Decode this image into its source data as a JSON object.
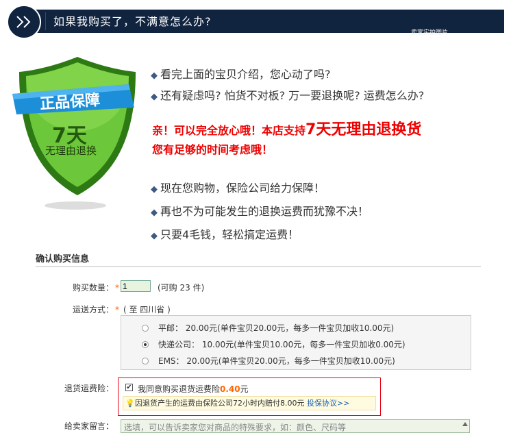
{
  "banner": {
    "title": "如果我购买了，不满意怎么办?",
    "faint_text": "卖家实拍图片"
  },
  "shield": {
    "ribbon": "正品保障",
    "days": "7天",
    "sub": "无理由退换"
  },
  "intro": {
    "bullet_glyph": "◆",
    "lines": [
      "看完上面的宝贝介绍，您心动了吗?",
      "还有疑虑吗? 怕货不对板? 万一要退换呢? 运费怎么办?"
    ],
    "red_line1_a": "亲！可以完全放心哦！本店支持",
    "red_line1_big": "7天无理由退换货",
    "red_line2": "您有足够的时间考虑哦！",
    "lines2": [
      "现在您购物，保险公司给力保障！",
      "再也不为可能发生的退换运费而犹豫不决！",
      "只要4毛钱，轻松搞定运费！"
    ]
  },
  "form": {
    "section_title": "确认购买信息",
    "qty_label": "购买数量：",
    "required_mark": "*",
    "qty_value": "1",
    "qty_note": "(可购 23 件)",
    "ship_label": "运送方式：",
    "ship_note": "( 至 四川省 )",
    "ship_options": [
      {
        "label": "平邮：  20.00元(单件宝贝20.00元，每多一件宝贝加收10.00元)",
        "selected": false
      },
      {
        "label": "快递公司：  10.00元(单件宝贝10.00元，每多一件宝贝加收0.00元)",
        "selected": true
      },
      {
        "label": "EMS：  20.00元(单件宝贝20.00元，每多一件宝贝加收10.00元)",
        "selected": false
      }
    ],
    "insurance_label": "退货运费险：",
    "insurance_checkbox": "✔",
    "insurance_text": "我同意购买退货运费险",
    "insurance_price": "0.40",
    "insurance_unit": "元",
    "tip_icon": "💡",
    "tip_text": "因退货产生的运费由保险公司72小时内赔付8.00元",
    "tip_link": "投保协议>>",
    "message_label": "给卖家留言：",
    "message_placeholder": "选填，可以告诉卖家您对商品的特殊要求，如：颜色、尺码等"
  },
  "colors": {
    "banner_bg": "#10233f",
    "red": "#e00",
    "orange": "#f60",
    "green_shield": "#5cb82a",
    "ribbon_blue": "#1c8fd8"
  }
}
